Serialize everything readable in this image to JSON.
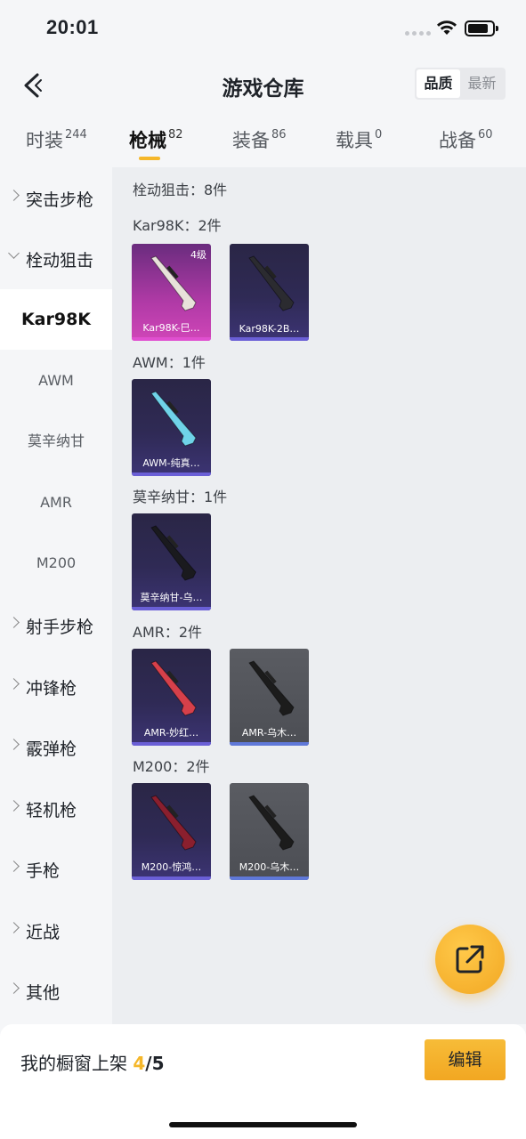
{
  "status_bar": {
    "time": "20:01"
  },
  "nav": {
    "title": "游戏仓库",
    "sort_options": [
      "品质",
      "最新"
    ],
    "sort_active": "品质"
  },
  "tabs": [
    {
      "label": "时装",
      "count": "244",
      "active": false
    },
    {
      "label": "枪械",
      "count": "82",
      "active": true
    },
    {
      "label": "装备",
      "count": "86",
      "active": false
    },
    {
      "label": "载具",
      "count": "0",
      "active": false
    },
    {
      "label": "战备",
      "count": "60",
      "active": false
    }
  ],
  "sidebar": {
    "items": [
      {
        "label": "突击步枪",
        "expanded": false
      },
      {
        "label": "栓动狙击",
        "expanded": true
      },
      {
        "label": "射手步枪",
        "expanded": false
      },
      {
        "label": "冲锋枪",
        "expanded": false
      },
      {
        "label": "霰弹枪",
        "expanded": false
      },
      {
        "label": "轻机枪",
        "expanded": false
      },
      {
        "label": "手枪",
        "expanded": false
      },
      {
        "label": "近战",
        "expanded": false
      },
      {
        "label": "其他",
        "expanded": false
      }
    ],
    "subitems": [
      "Kar98K",
      "AWM",
      "莫辛纳甘",
      "AMR",
      "M200"
    ],
    "selected_subitem": "Kar98K"
  },
  "content": {
    "category_summary": "栓动狙击：8件",
    "groups": [
      {
        "title": "Kar98K：2件",
        "cards": [
          {
            "name": "Kar98K-巳…",
            "rarity": "pink",
            "level": "4级",
            "gun": "#e8e2da"
          },
          {
            "name": "Kar98K-2B…",
            "rarity": "purple",
            "level": "",
            "gun": "#2b2b30"
          }
        ]
      },
      {
        "title": "AWM：1件",
        "cards": [
          {
            "name": "AWM-纯真…",
            "rarity": "purple",
            "level": "",
            "gun": "#6fd3e8"
          }
        ]
      },
      {
        "title": "莫辛纳甘：1件",
        "cards": [
          {
            "name": "莫辛纳甘-乌…",
            "rarity": "purple",
            "level": "",
            "gun": "#1a1a1e"
          }
        ]
      },
      {
        "title": "AMR：2件",
        "cards": [
          {
            "name": "AMR-妙红…",
            "rarity": "purple",
            "level": "",
            "gun": "#d6404a"
          },
          {
            "name": "AMR-乌木…",
            "rarity": "gray",
            "level": "",
            "gun": "#1c1c1c"
          }
        ]
      },
      {
        "title": "M200：2件",
        "cards": [
          {
            "name": "M200-惊鸿…",
            "rarity": "purple",
            "level": "",
            "gun": "#8a1f2e"
          },
          {
            "name": "M200-乌木…",
            "rarity": "gray",
            "level": "",
            "gun": "#1c1c1c"
          }
        ]
      }
    ]
  },
  "bottom": {
    "showcase_label": "我的橱窗上架",
    "showcase_count": "4",
    "showcase_total": "/5",
    "edit_label": "编辑"
  },
  "colors": {
    "accent": "#f5b72a",
    "purple_rarity": "#6a5fd6",
    "pink_rarity": "#e04fd0"
  }
}
